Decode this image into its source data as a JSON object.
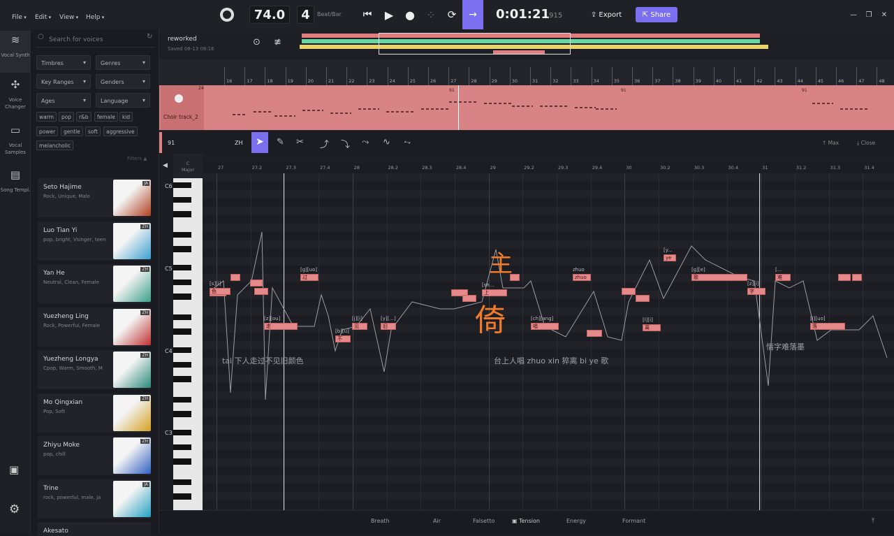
{
  "menu": [
    "File",
    "Edit",
    "View",
    "Help"
  ],
  "transport": {
    "tempo": "74.0",
    "beats": "4",
    "beats_label": "Beat/Bar",
    "time": "0:01:21",
    "time_ms": ".915",
    "export": "Export",
    "share": "Share"
  },
  "rail": [
    {
      "label": "Vocal Synth",
      "icon": "waveform-icon"
    },
    {
      "label": "Voice Changer",
      "icon": "voice-changer-icon"
    },
    {
      "label": "Vocal Samples",
      "icon": "samples-icon"
    },
    {
      "label": "Song Templ.",
      "icon": "template-icon"
    }
  ],
  "search": {
    "placeholder": "Search for voices"
  },
  "filters": [
    "Timbres",
    "Genres",
    "Key Ranges",
    "Genders",
    "Ages",
    "Language"
  ],
  "tags": [
    "warm",
    "pop",
    "r&b",
    "female",
    "kid",
    "power",
    "gentle",
    "soft",
    "aggressive",
    "melancholic"
  ],
  "filters_label": "Filters ▲",
  "voices": [
    {
      "name": "Seto Hajime",
      "desc": "Rock, Unique, Male",
      "lang": "JA",
      "color": "#b04020"
    },
    {
      "name": "Luo Tian Yi",
      "desc": "pop, bright, Vsinger, teen",
      "lang": "ZH",
      "color": "#3aa0d0"
    },
    {
      "name": "Yan He",
      "desc": "Neutral, Clean, Female",
      "lang": "ZH",
      "color": "#3aa08a"
    },
    {
      "name": "Yuezheng Ling",
      "desc": "Rock, Powerful, Female",
      "lang": "ZH",
      "color": "#c03030"
    },
    {
      "name": "Yuezheng Longya",
      "desc": "Cpop, Warm, Smooth, M",
      "lang": "ZH",
      "color": "#2a8a7a"
    },
    {
      "name": "Mo Qingxian",
      "desc": "Pop, Soft",
      "lang": "ZH",
      "color": "#d4a020"
    },
    {
      "name": "Zhiyu Moke",
      "desc": "pop, chill",
      "lang": "ZH",
      "color": "#3060c0"
    },
    {
      "name": "Trine",
      "desc": "rock, powerful, male, ja",
      "lang": "JA",
      "color": "#20a0c0"
    },
    {
      "name": "Akesato",
      "desc": "",
      "lang": "",
      "color": "#a04060"
    }
  ],
  "project": {
    "name": "reworked",
    "saved": "Saved 08-13 08:16"
  },
  "track": {
    "name": "Choir track_2",
    "bar": "24",
    "marker": "91"
  },
  "ruler_top": [
    "16",
    "17",
    "18",
    "19",
    "20",
    "21",
    "22",
    "23",
    "24",
    "25",
    "26",
    "27",
    "28",
    "29",
    "30",
    "31",
    "32",
    "33",
    "34",
    "35",
    "36",
    "37",
    "38",
    "39",
    "40",
    "41",
    "42",
    "43",
    "44",
    "45",
    "46",
    "47",
    "48"
  ],
  "editor": {
    "track_no": "91",
    "lang": "ZH",
    "max": "Max",
    "close": "Close",
    "key": "C",
    "scale": "Major"
  },
  "ruler_bottom": [
    "27",
    "27.2",
    "27.3",
    "27.4",
    "28",
    "28.2",
    "28.3",
    "28.4",
    "29",
    "29.2",
    "29.3",
    "29.4",
    "30",
    "30.2",
    "30.3",
    "30.4",
    "31",
    "31.2",
    "31.3",
    "31.4"
  ],
  "octaves": [
    "C6",
    "C5",
    "C4",
    "C3"
  ],
  "lyrics": [
    "tai 下人走过不见旧颜色",
    "台上人唱 zhuo xin 猝离 bi ye 歌",
    "情字难落墨"
  ],
  "overlay_chars": [
    "主",
    "倚"
  ],
  "bottom_tabs": [
    "Breath",
    "Air",
    "Falsetto",
    "Tension",
    "Energy",
    "Formant"
  ],
  "notes": [
    {
      "l": "",
      "p": ""
    },
    {
      "l": "[z][ou]",
      "p": "走"
    },
    {
      "l": "[b][u]",
      "p": "不"
    },
    {
      "l": "[j][i]",
      "p": "见"
    },
    {
      "l": "[y][...]",
      "p": "旧"
    },
    {
      "l": "[g][uo]",
      "p": "过"
    },
    {
      "l": "[sh...",
      "p": "上"
    },
    {
      "l": "zhuo",
      "p": "zhuo"
    },
    {
      "l": "[ch][ang]",
      "p": "唱"
    },
    {
      "l": "[l][i]",
      "p": "离"
    },
    {
      "l": "[y...",
      "p": "ye"
    },
    {
      "l": "[g][e]",
      "p": "歌"
    },
    {
      "l": "[s][i]",
      "p": "色"
    },
    {
      "l": "[z][i]",
      "p": "字"
    },
    {
      "l": "[l][uo]",
      "p": "落"
    },
    {
      "l": "[...",
      "p": "难"
    }
  ]
}
